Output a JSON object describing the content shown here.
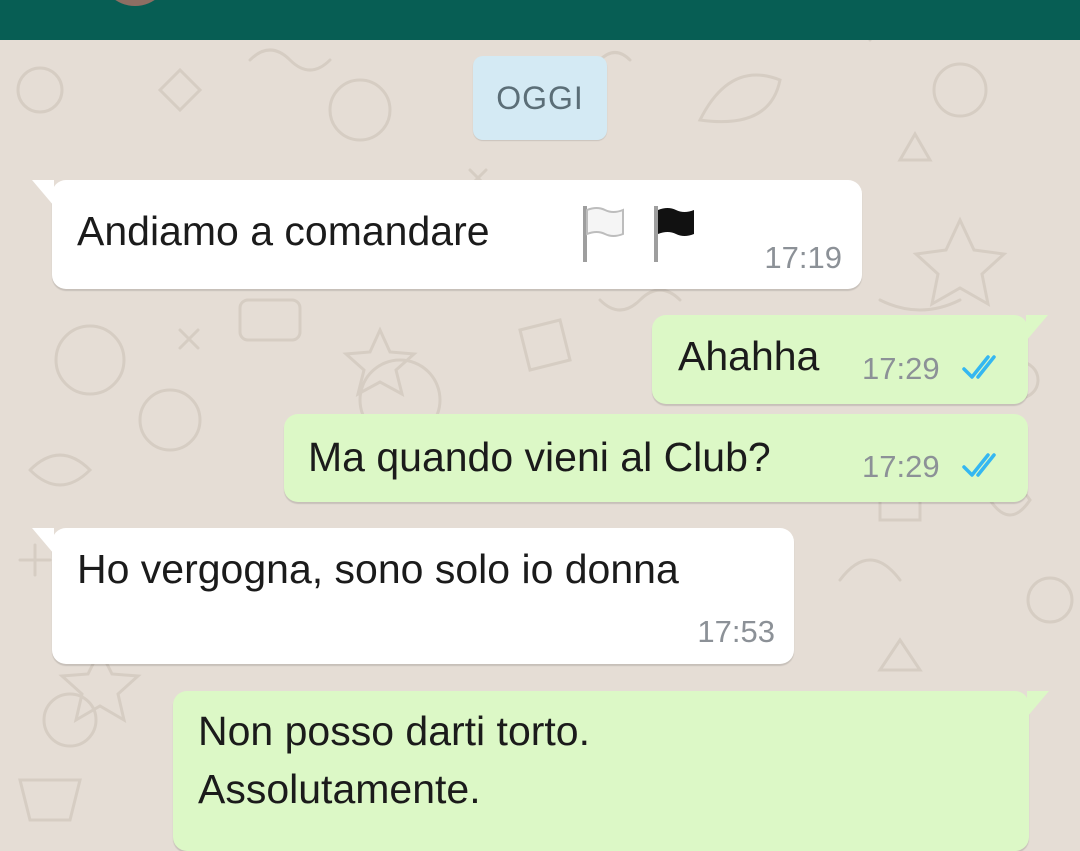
{
  "date_separator": "OGGI",
  "messages": [
    {
      "direction": "incoming",
      "text": "Andiamo a comandare",
      "emoji": [
        "white-flag-icon",
        "black-flag-icon"
      ],
      "time": "17:19"
    },
    {
      "direction": "outgoing",
      "text": "Ahahha",
      "time": "17:29",
      "status": "read"
    },
    {
      "direction": "outgoing",
      "text": "Ma quando vieni al Club?",
      "time": "17:29",
      "status": "read"
    },
    {
      "direction": "incoming",
      "text": "Ho vergogna, sono solo io donna",
      "time": "17:53"
    },
    {
      "direction": "outgoing",
      "text": "Non posso darti torto.\nAssolutamente."
    }
  ],
  "colors": {
    "header": "#075e54",
    "wallpaper": "#e5ddd5",
    "incoming_bubble": "#ffffff",
    "outgoing_bubble": "#dcf8c6",
    "date_chip": "#d4eaf4",
    "read_ticks": "#34b7f1"
  }
}
